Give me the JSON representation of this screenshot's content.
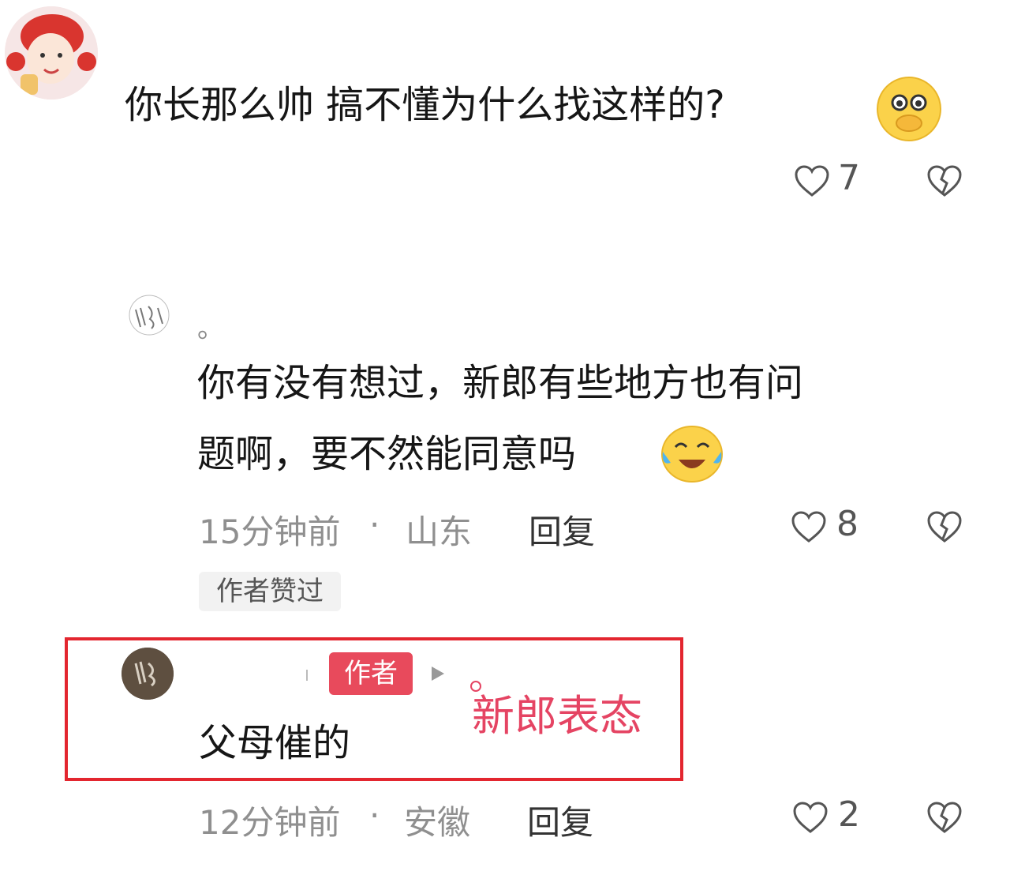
{
  "comments": [
    {
      "avatar_icon": "cartoon-girl-avatar",
      "text": "你长那么帅 搞不懂为什么找这样的?",
      "emoji": "covering-mouth-emoji",
      "likes": "7"
    },
    {
      "avatar_icon": "handwritten-avatar",
      "username": "。",
      "text_line1": "你有没有想过，新郎有些地方也有问",
      "text_line2": "题啊，要不然能同意吗",
      "emoji": "tears-of-joy-emoji",
      "time": "15分钟前",
      "location": "山东",
      "reply_label": "回复",
      "likes": "8",
      "liked_by_author_tag": "作者赞过"
    },
    {
      "avatar_icon": "dark-round-avatar",
      "author_badge": "作者",
      "text": "父母催的",
      "time": "12分钟前",
      "location": "安徽",
      "reply_label": "回复",
      "likes": "2"
    }
  ],
  "annotation": "新郎表态",
  "colors": {
    "highlight_border": "#e3262f",
    "annotation_text": "#e54463",
    "author_badge": "#e84a5c",
    "meta_text": "#8f8f8f"
  }
}
